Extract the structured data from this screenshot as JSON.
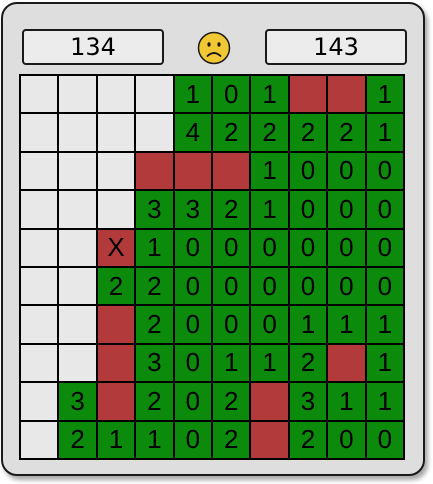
{
  "counters": {
    "left": "134",
    "right": "143"
  },
  "status": {
    "face_icon": "frown-face-icon",
    "face_color": "#f2c734"
  },
  "colors": {
    "hidden": "#e8e8e8",
    "revealed": "#0b8a0b",
    "flagged": "#b33a3a"
  },
  "board": {
    "rows": [
      [
        "H",
        "H",
        "H",
        "H",
        "1",
        "0",
        "1",
        "F",
        "F",
        "1"
      ],
      [
        "H",
        "H",
        "H",
        "H",
        "4",
        "2",
        "2",
        "2",
        "2",
        "1"
      ],
      [
        "H",
        "H",
        "H",
        "F",
        "F",
        "F",
        "1",
        "0",
        "0",
        "0"
      ],
      [
        "H",
        "H",
        "H",
        "3",
        "3",
        "2",
        "1",
        "0",
        "0",
        "0"
      ],
      [
        "H",
        "H",
        "X",
        "1",
        "0",
        "0",
        "0",
        "0",
        "0",
        "0"
      ],
      [
        "H",
        "H",
        "2",
        "2",
        "0",
        "0",
        "0",
        "0",
        "0",
        "0"
      ],
      [
        "H",
        "H",
        "F",
        "2",
        "0",
        "0",
        "0",
        "1",
        "1",
        "1"
      ],
      [
        "H",
        "H",
        "F",
        "3",
        "0",
        "1",
        "1",
        "2",
        "F",
        "1"
      ],
      [
        "H",
        "3",
        "F",
        "2",
        "0",
        "2",
        "F",
        "3",
        "1",
        "1"
      ],
      [
        "H",
        "2",
        "1",
        "1",
        "0",
        "2",
        "F",
        "2",
        "0",
        "0"
      ]
    ]
  }
}
